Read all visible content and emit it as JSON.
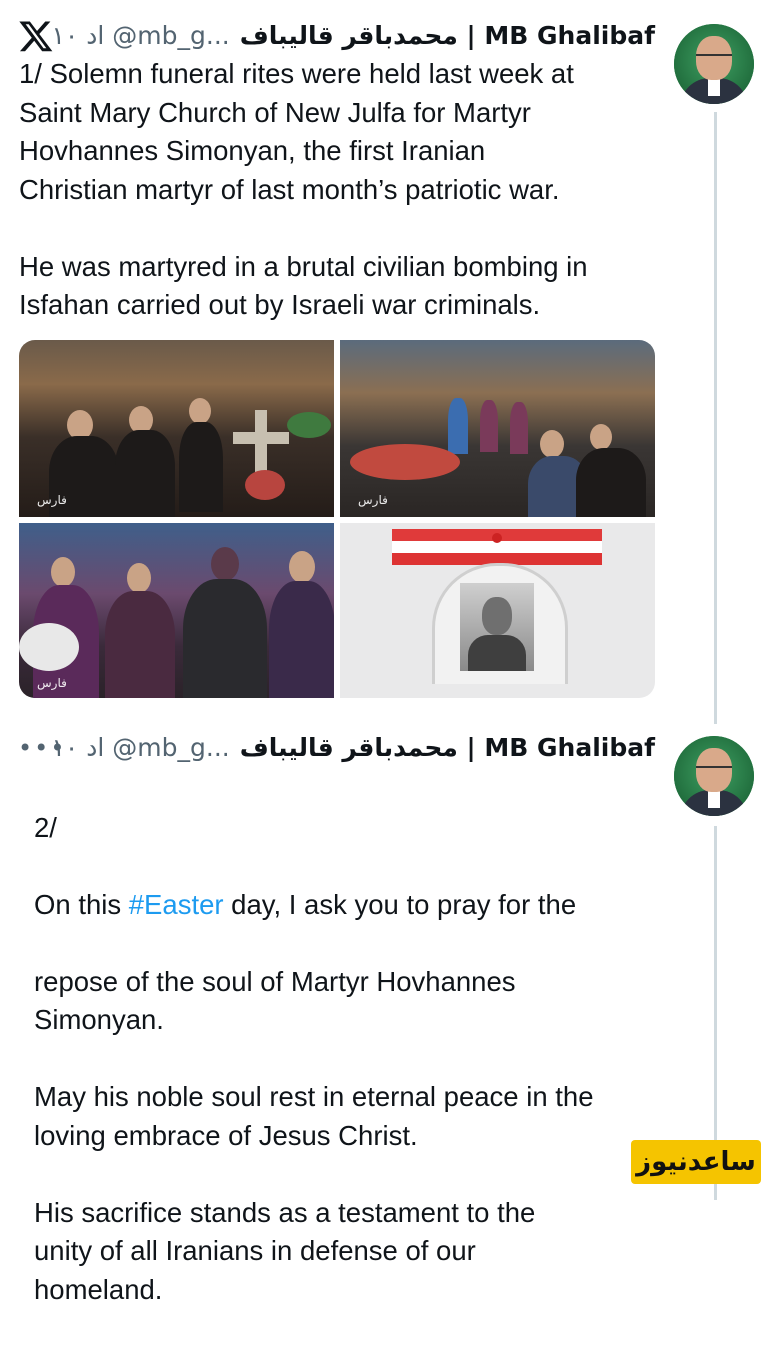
{
  "tweet1": {
    "display_name": "محمدباقر قالیباف | MB Ghalibaf",
    "handle_time": "ا‌د ۱۰ ‌@mb_g...",
    "text": "1/ Solemn funeral rites were held last week at\nSaint Mary Church of New Julfa for Martyr\nHovhannes Simonyan, the first Iranian\nChristian martyr of last month’s patriotic war.\n\nHe was martyred in a brutal civilian bombing in\nIsfahan carried out by Israeli war criminals.",
    "photo_watermark": "فارس"
  },
  "tweet2": {
    "display_name": "محمدباقر قالیباف | MB Ghalibaf",
    "handle_time": "ا‌د ۱۰ ‌@mb_g...",
    "more_label": "•••",
    "line1": "2/",
    "line2_pre": "On this ",
    "hashtag": "#Easter",
    "line2_post": " day, I ask you to pray for the",
    "rest": "repose of the soul of Martyr Hovhannes\nSimonyan.\n\nMay his noble soul rest in eternal peace in the\nloving embrace of Jesus Christ.\n\nHis sacrifice stands as a testament to the\nunity of all Iranians in defense of our\nhomeland."
  },
  "watermark_logo": "ساعدنیوز",
  "colors": {
    "link": "#1d9bf0",
    "muted": "#536471",
    "thread_line": "#cfd9de",
    "logo_bg": "#f5c400"
  },
  "icons": {
    "app": "x-logo-icon",
    "more": "more-dots-icon"
  }
}
